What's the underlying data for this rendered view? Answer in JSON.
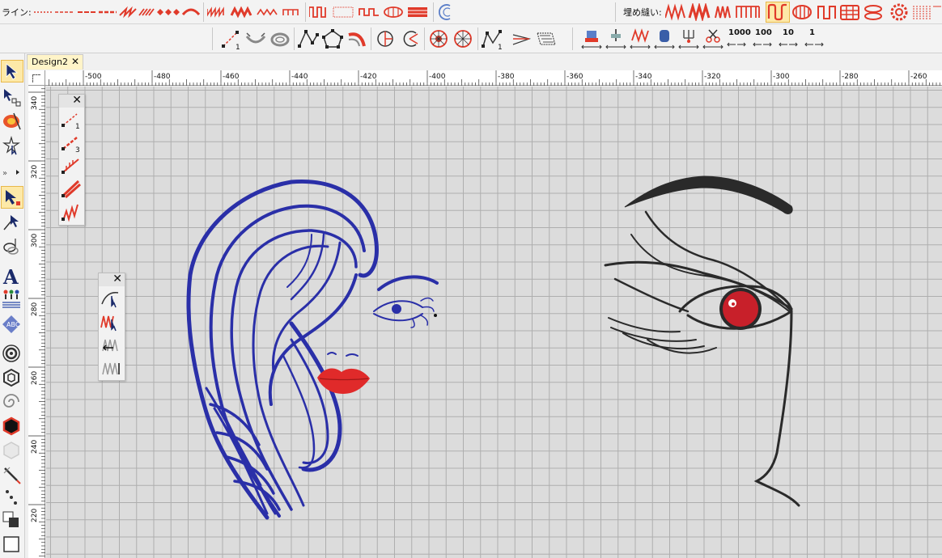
{
  "toolbar": {
    "line_label": "ライン:",
    "fill_label": "埋め縫い:",
    "count_labels": [
      "1000",
      "100",
      "10",
      "1"
    ]
  },
  "document": {
    "tab_title": "Design2",
    "close_glyph": "✕"
  },
  "ruler": {
    "h_ticks": [
      "-500",
      "-480",
      "-460",
      "-440",
      "-420",
      "-400",
      "-380",
      "-360",
      "-340",
      "-320",
      "-300",
      "-280",
      "-260"
    ],
    "v_ticks": [
      "340",
      "320",
      "300",
      "280",
      "260",
      "240",
      "220"
    ]
  },
  "palettes": {
    "line_palette_close": "✕",
    "edit_palette_close": "✕",
    "line_palette_labels": [
      "1",
      "3"
    ]
  },
  "colors": {
    "hair_blue": "#2a2fa8",
    "lips_red": "#e02a2a",
    "eye_red": "#c8202a",
    "brow_black": "#2a2a2a",
    "toolbar_active": "#fde9a8",
    "icon_red": "#e03a2a"
  },
  "icons": {
    "toolbox": [
      "select-arrow-icon",
      "point-edit-icon",
      "color-pick-icon",
      "star-select-icon",
      "reshape-icon",
      "node-edit-icon",
      "stitch-icon",
      "text-A-icon",
      "people-icon",
      "monogram-icon",
      "circle-target-icon",
      "hexagon-icon",
      "spiral-icon",
      "hexagon-red-icon",
      "hexagon-gray-icon",
      "needle-icon",
      "dots-icon",
      "square-icon"
    ]
  }
}
